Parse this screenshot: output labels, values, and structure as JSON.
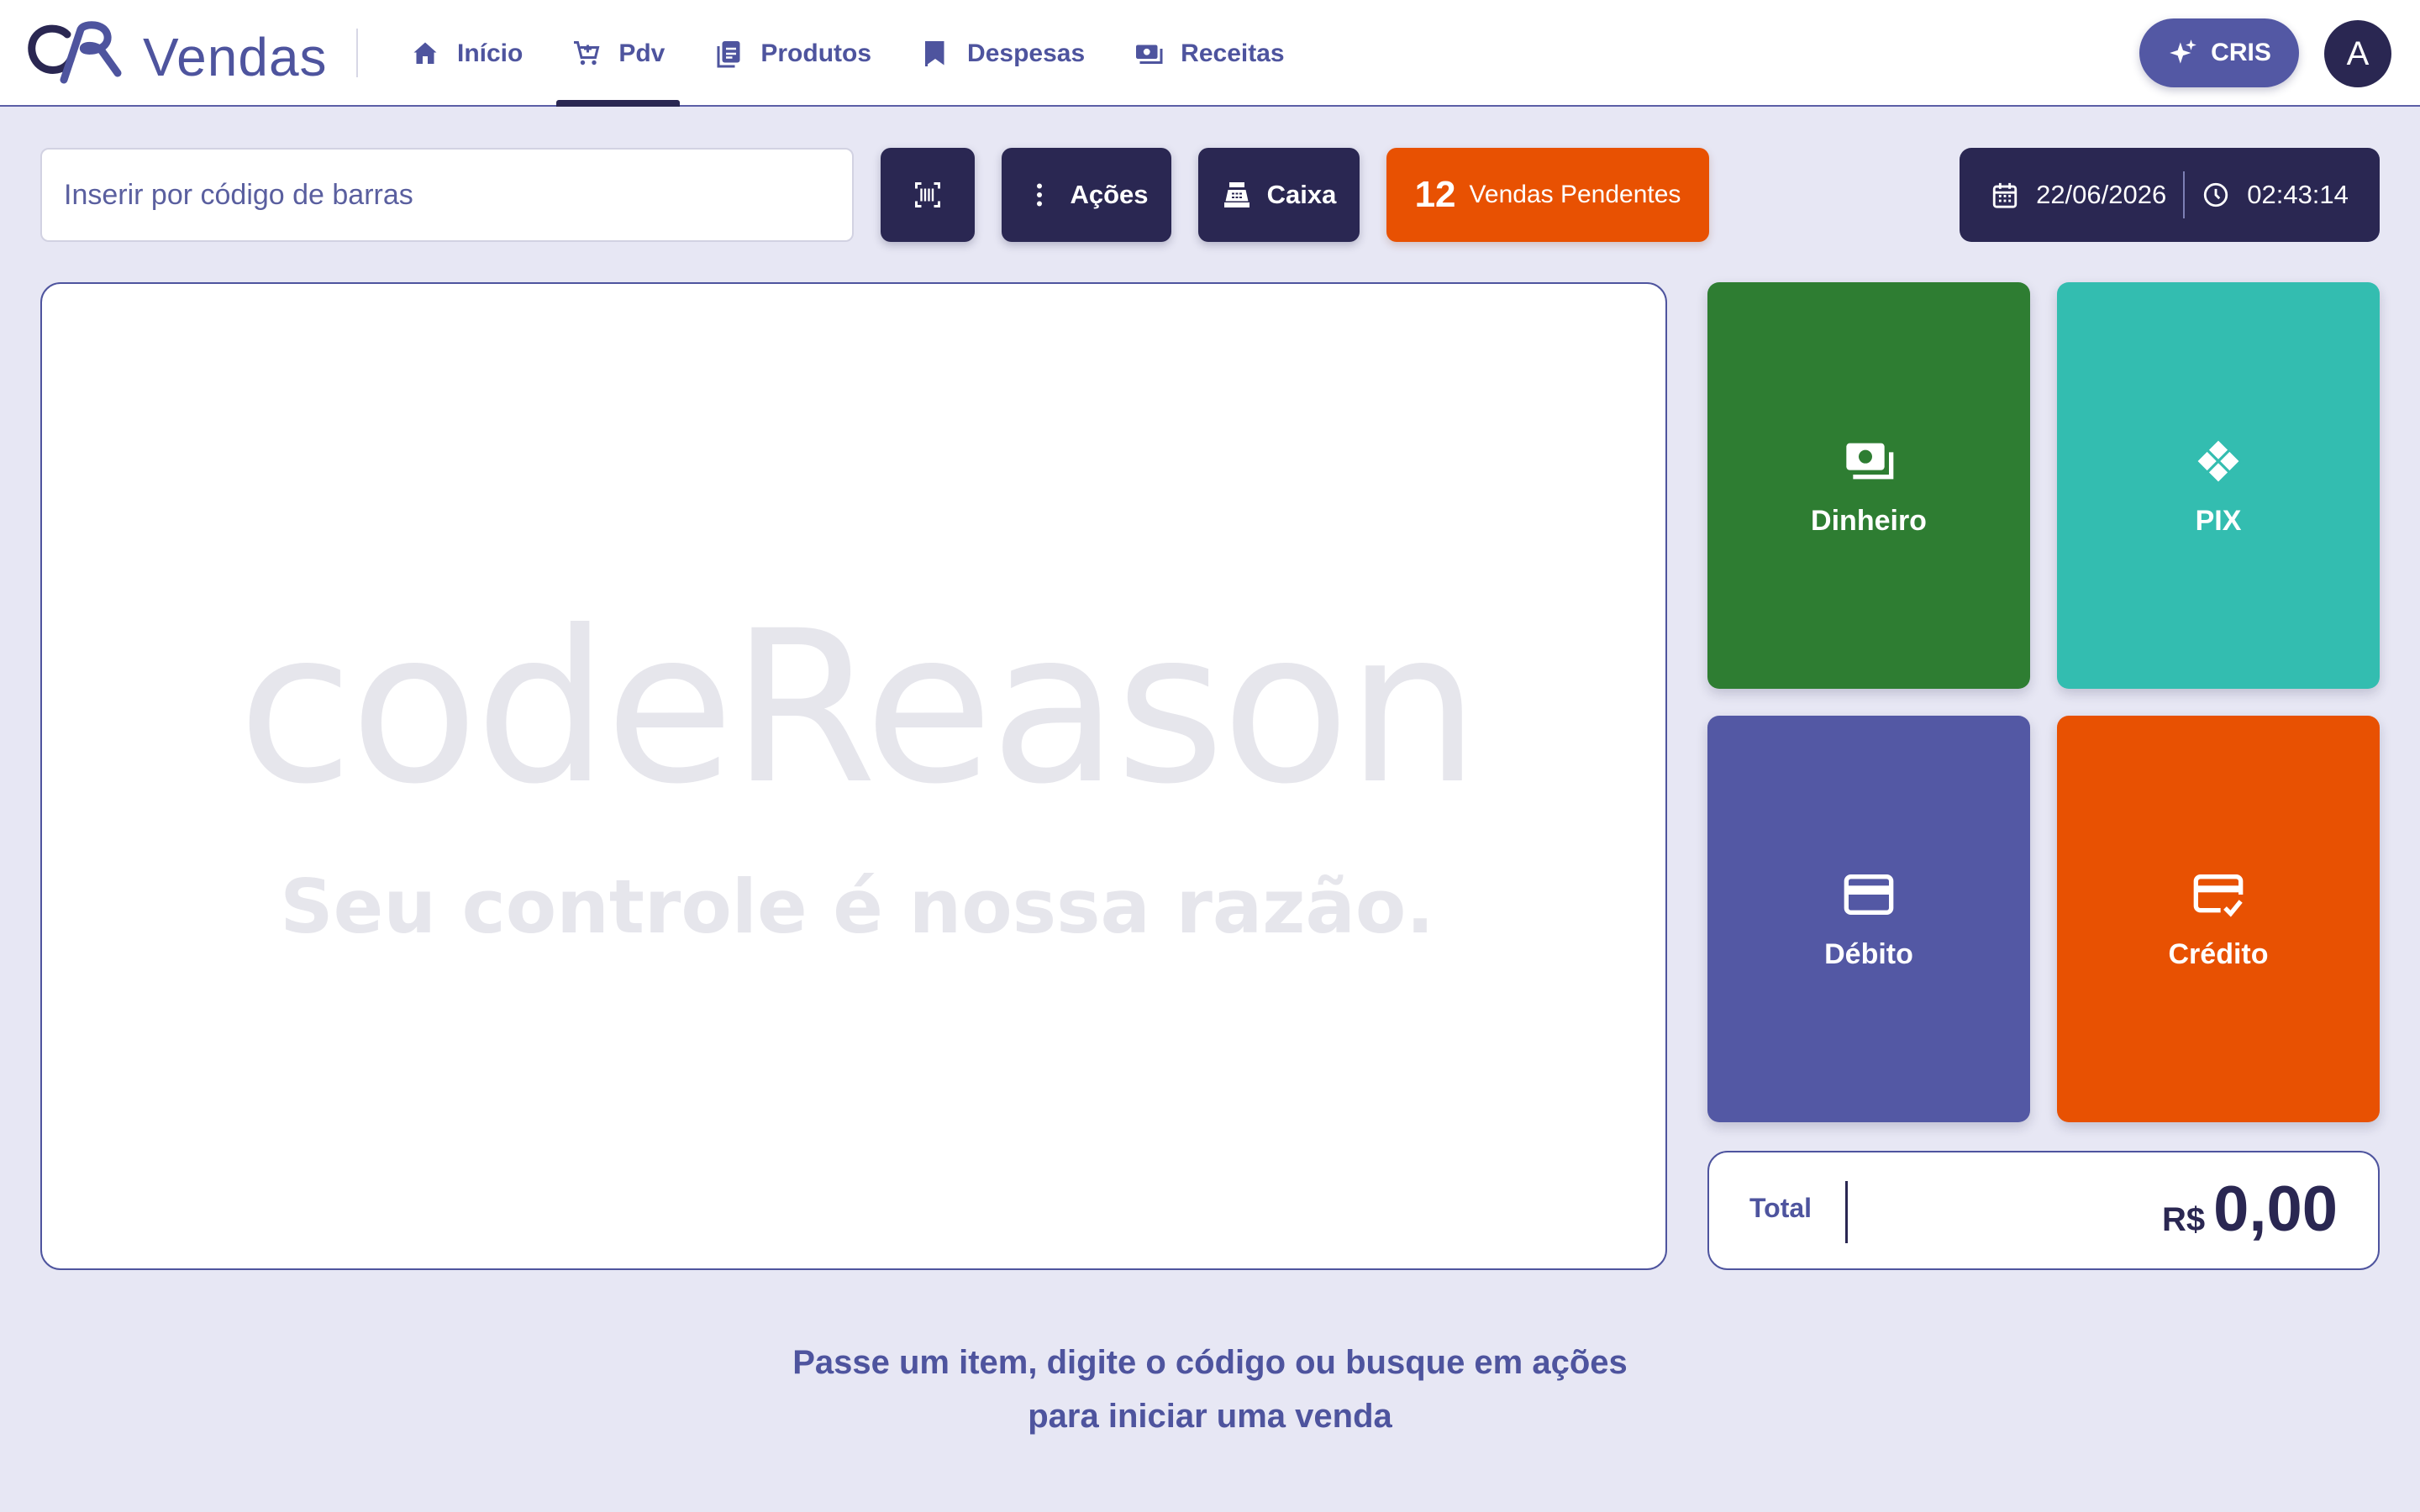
{
  "app": {
    "title": "Vendas"
  },
  "nav": {
    "items": [
      {
        "label": "Início",
        "icon": "home-icon",
        "active": false
      },
      {
        "label": "Pdv",
        "icon": "cart-icon",
        "active": true
      },
      {
        "label": "Produtos",
        "icon": "product-list-icon",
        "active": false
      },
      {
        "label": "Despesas",
        "icon": "bookmark-flag-icon",
        "active": false
      },
      {
        "label": "Receitas",
        "icon": "money-icon",
        "active": false
      }
    ]
  },
  "header": {
    "assistant_label": "CRIS",
    "avatar_initial": "A"
  },
  "toolbar": {
    "barcode_placeholder": "Inserir por código de barras",
    "actions_label": "Ações",
    "cashier_label": "Caixa",
    "pending_count": "12",
    "pending_label": "Vendas Pendentes"
  },
  "datetime": {
    "date": "22/06/2026",
    "time": "02:43:14"
  },
  "brand": {
    "name": "codeReason",
    "slogan": "Seu controle é nossa razão."
  },
  "payments": {
    "cash": "Dinheiro",
    "pix": "PIX",
    "debit": "Débito",
    "credit": "Crédito"
  },
  "total": {
    "label": "Total",
    "currency": "R$",
    "amount": "0,00"
  },
  "hint": {
    "line1": "Passe um item, digite o código ou busque em ações",
    "line2": "para iniciar uma venda"
  },
  "colors": {
    "primary": "#2a2752",
    "accent": "#5358a4",
    "orange": "#e85102",
    "green": "#2e7d32",
    "teal": "#33bdb0",
    "background": "#e7e7f4"
  }
}
